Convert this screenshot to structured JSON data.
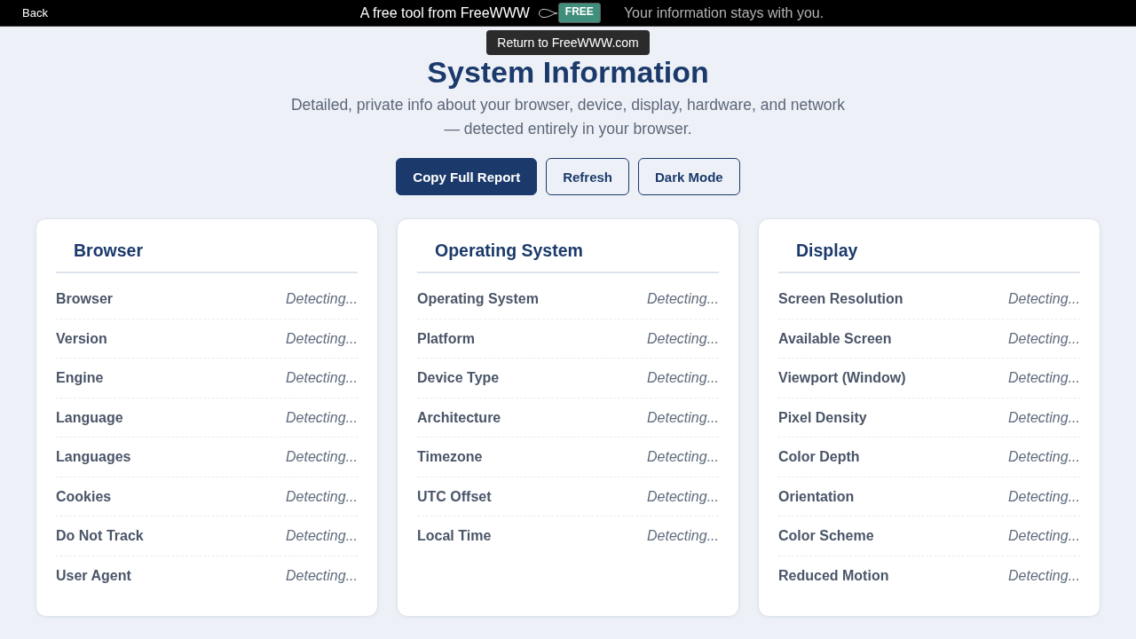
{
  "top_bar": {
    "back": "Back",
    "tagline": "A free tool from FreeWWW",
    "badge": "FREE",
    "privacy_note": "Your information stays with you."
  },
  "tooltip": "Return to FreeWWW.com",
  "title": "System Information",
  "subtitle": [
    "Detailed, private info about your browser, device, display, hardware, and network",
    "— detected entirely in your browser."
  ],
  "buttons": [
    {
      "label": "Copy Full Report",
      "kind": "primary"
    },
    {
      "label": "Refresh",
      "kind": "secondary"
    },
    {
      "label": "Dark Mode",
      "kind": "secondary"
    }
  ],
  "cards": [
    {
      "title": "Browser",
      "rows": [
        {
          "label": "Browser",
          "value": "Detecting..."
        },
        {
          "label": "Version",
          "value": "Detecting..."
        },
        {
          "label": "Engine",
          "value": "Detecting..."
        },
        {
          "label": "Language",
          "value": "Detecting..."
        },
        {
          "label": "Languages",
          "value": "Detecting..."
        },
        {
          "label": "Cookies",
          "value": "Detecting..."
        },
        {
          "label": "Do Not Track",
          "value": "Detecting..."
        },
        {
          "label": "User Agent",
          "value": "Detecting..."
        }
      ]
    },
    {
      "title": "Operating System",
      "rows": [
        {
          "label": "Operating System",
          "value": "Detecting..."
        },
        {
          "label": "Platform",
          "value": "Detecting..."
        },
        {
          "label": "Device Type",
          "value": "Detecting..."
        },
        {
          "label": "Architecture",
          "value": "Detecting..."
        },
        {
          "label": "Timezone",
          "value": "Detecting..."
        },
        {
          "label": "UTC Offset",
          "value": "Detecting..."
        },
        {
          "label": "Local Time",
          "value": "Detecting..."
        }
      ]
    },
    {
      "title": "Display",
      "rows": [
        {
          "label": "Screen Resolution",
          "value": "Detecting..."
        },
        {
          "label": "Available Screen",
          "value": "Detecting..."
        },
        {
          "label": "Viewport (Window)",
          "value": "Detecting..."
        },
        {
          "label": "Pixel Density",
          "value": "Detecting..."
        },
        {
          "label": "Color Depth",
          "value": "Detecting..."
        },
        {
          "label": "Orientation",
          "value": "Detecting..."
        },
        {
          "label": "Color Scheme",
          "value": "Detecting..."
        },
        {
          "label": "Reduced Motion",
          "value": "Detecting..."
        }
      ]
    }
  ]
}
